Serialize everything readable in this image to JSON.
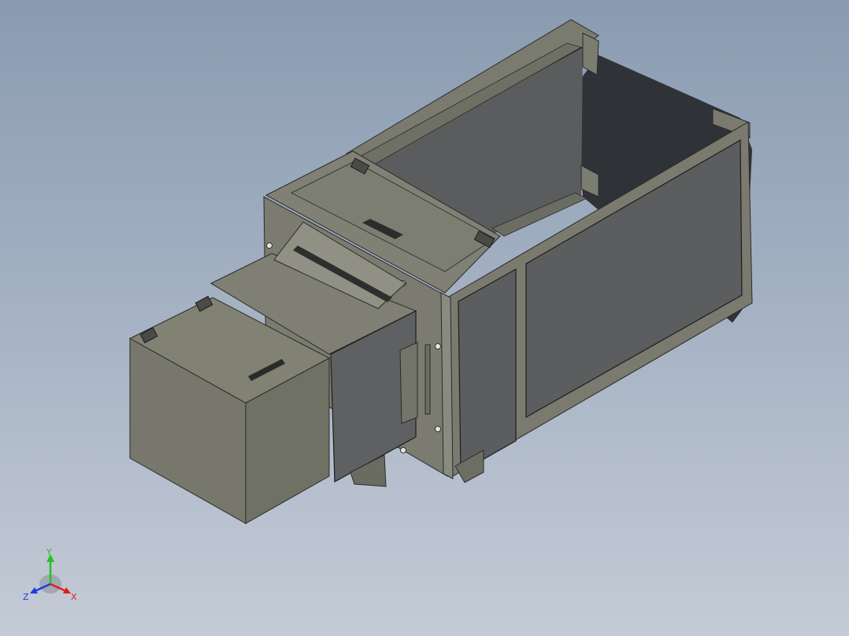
{
  "viewport": {
    "model": "enclosure-assembly"
  },
  "triad": {
    "y_label": "Y",
    "x_label": "X",
    "z_label": "Z",
    "colors": {
      "y": "#22c322",
      "x": "#e01e1e",
      "z": "#1e3ce0"
    }
  },
  "colors": {
    "background_top": "#8a9bb1",
    "background_bottom": "#c4cbd6",
    "body": "#7d7e70",
    "panel": "#5f6061",
    "dark_interior": "#2e3135"
  }
}
